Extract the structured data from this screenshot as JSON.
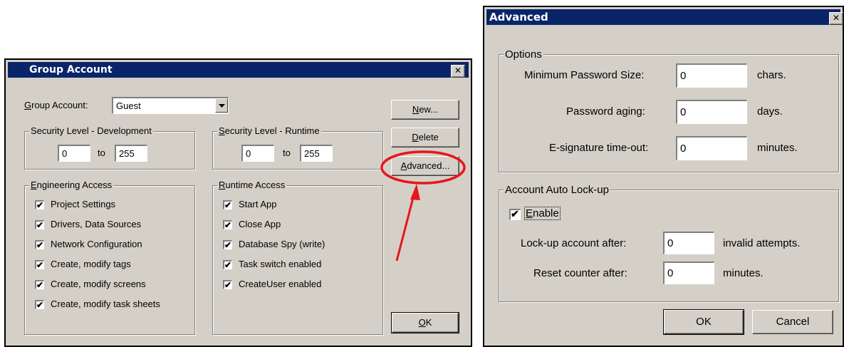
{
  "group_window": {
    "title": "Group Account",
    "close_glyph": "✕",
    "group_account_label_first": "G",
    "group_account_label_rest": "roup Account:",
    "group_account_value": "Guest",
    "buttons": {
      "new_first": "N",
      "new_rest": "ew...",
      "delete_first": "D",
      "delete_rest": "elete",
      "advanced_first": "A",
      "advanced_rest": "dvanced...",
      "ok_first": "O",
      "ok_rest": "K"
    },
    "security_dev": {
      "title": "Security Level - Development",
      "from": "0",
      "to_label": "to",
      "to": "255"
    },
    "security_runtime": {
      "title_first": "S",
      "title_rest": "ecurity Level - Runtime",
      "from": "0",
      "to_label": "to",
      "to": "255"
    },
    "engineering_access": {
      "title_first": "E",
      "title_rest": "ngineering Access",
      "items": [
        {
          "label": "Project Settings",
          "checked": true
        },
        {
          "label": "Drivers, Data Sources",
          "checked": true
        },
        {
          "label": "Network Configuration",
          "checked": true
        },
        {
          "label": "Create, modify tags",
          "checked": true
        },
        {
          "label": "Create, modify screens",
          "checked": true
        },
        {
          "label": "Create, modify task sheets",
          "checked": true
        }
      ]
    },
    "runtime_access": {
      "title_first": "R",
      "title_rest": "untime Access",
      "items": [
        {
          "label": "Start App",
          "checked": true
        },
        {
          "label": "Close App",
          "checked": true
        },
        {
          "label": "Database Spy (write)",
          "checked": true
        },
        {
          "label": "Task switch enabled",
          "checked": true
        },
        {
          "label": "CreateUser enabled",
          "checked": true
        }
      ]
    },
    "checkmark": "✔"
  },
  "advanced_window": {
    "title": "Advanced",
    "close_glyph": "✕",
    "options": {
      "title": "Options",
      "min_password_label": "Minimum Password Size:",
      "min_password_value": "0",
      "min_password_unit": "chars.",
      "password_aging_label": "Password aging:",
      "password_aging_value": "0",
      "password_aging_unit": "days.",
      "esig_label": "E-signature time-out:",
      "esig_value": "0",
      "esig_unit": "minutes."
    },
    "lockup": {
      "title": "Account Auto Lock-up",
      "enable_first": "E",
      "enable_rest": "nable",
      "enable_checked": true,
      "lockup_after_label": "Lock-up account after:",
      "lockup_after_value": "0",
      "lockup_after_unit": "invalid attempts.",
      "reset_label": "Reset counter after:",
      "reset_value": "0",
      "reset_unit": "minutes."
    },
    "ok_label": "OK",
    "cancel_label": "Cancel"
  },
  "annotation_color": "#e8161b"
}
